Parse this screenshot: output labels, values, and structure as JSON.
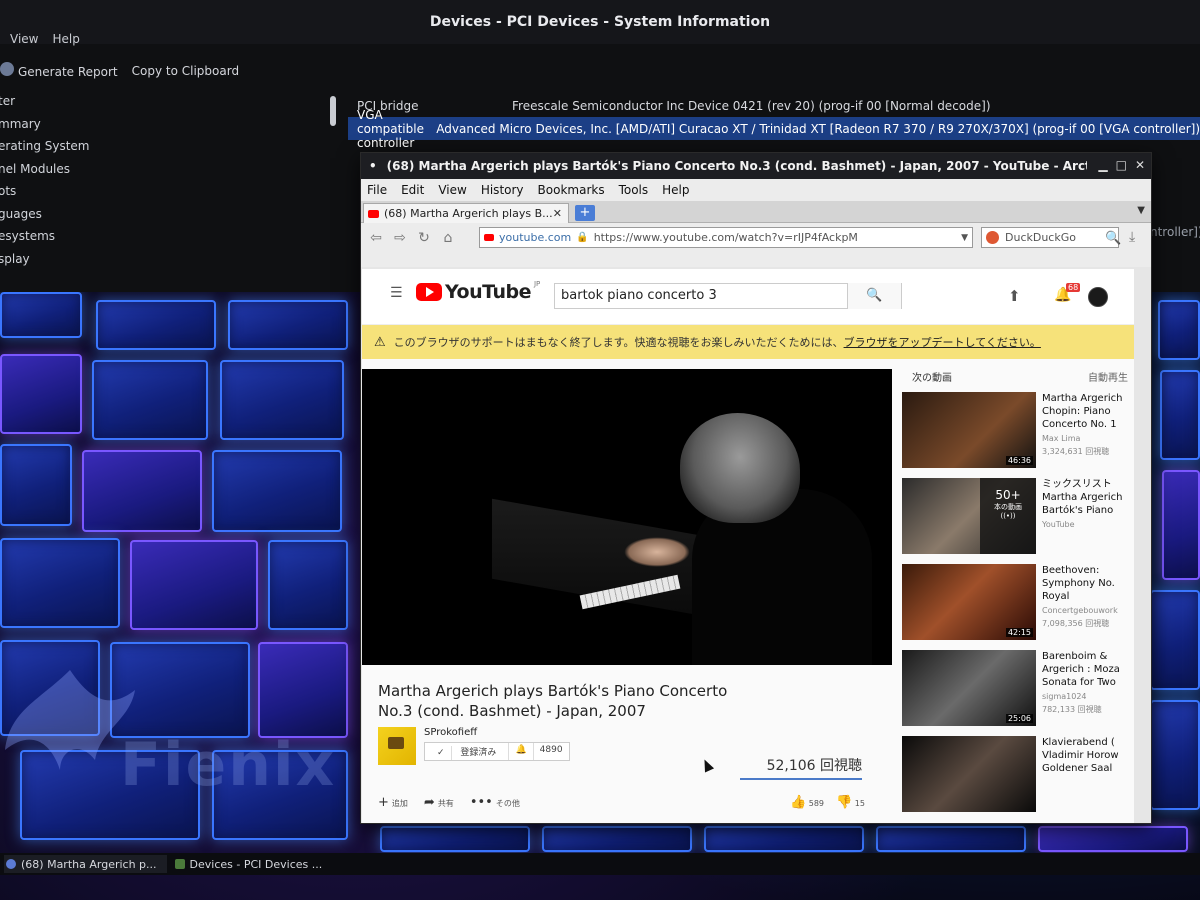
{
  "sysinfo": {
    "title": "Devices - PCI Devices - System Information",
    "menu": [
      "View",
      "Help"
    ],
    "toolbar": {
      "generate_report": "Generate Report",
      "copy_clipboard": "Copy to Clipboard"
    },
    "tree": [
      "ter",
      "mmary",
      "erating System",
      "nel Modules",
      "ots",
      "guages",
      "esystems",
      "splay"
    ],
    "rows": [
      {
        "key": "PCI bridge",
        "value": "Freescale Semiconductor Inc Device 0421 (rev 20) (prog-if 00 [Normal decode])"
      },
      {
        "key": "VGA compatible controller",
        "value": "Advanced Micro Devices, Inc. [AMD/ATI] Curacao XT / Trinidad XT [Radeon R7 370 / R9 270X/370X] (prog-if 00 [VGA controller])"
      }
    ],
    "row_tail": "ntroller])"
  },
  "desktop": {
    "logo_text": "Fienix"
  },
  "taskbar": {
    "items": [
      "(68) Martha Argerich p...",
      "Devices - PCI Devices ..."
    ]
  },
  "firefox": {
    "window_title": "(68) Martha Argerich plays Bartók's Piano Concerto No.3 (cond. Bashmet) - Japan, 2007 - YouTube - Arctic...",
    "menu": [
      "File",
      "Edit",
      "View",
      "History",
      "Bookmarks",
      "Tools",
      "Help"
    ],
    "tab_title": "(68) Martha Argerich plays B...",
    "url_site": "youtube.com",
    "url": "https://www.youtube.com/watch?v=rIJP4fAckpM",
    "search_engine": "DuckDuckGo"
  },
  "youtube": {
    "logo_word": "YouTube",
    "logo_region": "JP",
    "search_query": "bartok piano concerto 3",
    "notification_count": "68",
    "warning_text": "このブラウザのサポートはまもなく終了します。快適な視聴をお楽しみいただくためには、",
    "warning_link": "ブラウザをアップデートしてください。",
    "video_title": "Martha Argerich plays Bartók's Piano Concerto No.3 (cond. Bashmet) - Japan, 2007",
    "channel_name": "SProkofieff",
    "subscribed_label": "登録済み",
    "subscriber_count": "4890",
    "view_count": "52,106 回視聴",
    "actions": {
      "add": "追加",
      "share": "共有",
      "more": "その他"
    },
    "likes": "589",
    "dislikes": "15",
    "up_next_label": "次の動画",
    "autoplay_label": "自動再生",
    "recommendations": [
      {
        "title": "Martha Argerich Chopin: Piano Concerto No. 1",
        "channel": "Max Lima",
        "views": "3,324,631 回視聴",
        "duration": "46:36"
      },
      {
        "title": "ミックスリスト Martha Argerich Bartók's Piano",
        "channel": "YouTube",
        "views": "",
        "duration": "",
        "mix_count": "50+",
        "mix_label": "本の動画"
      },
      {
        "title": "Beethoven: Symphony No. Royal",
        "channel": "Concertgebouwork",
        "views": "7,098,356 回視聴",
        "duration": "42:15"
      },
      {
        "title": "Barenboim & Argerich : Moza Sonata for Two",
        "channel": "sigma1024",
        "views": "782,133 回視聴",
        "duration": "25:06"
      },
      {
        "title": "Klavierabend ( Vladimir Horow Goldener Saal",
        "channel": "",
        "views": "",
        "duration": ""
      }
    ]
  },
  "colors": {
    "selection": "#1c3f86",
    "youtube_red": "#ff0000",
    "warning_bg": "#f6e27a",
    "tile_glow": "#3a76ff"
  }
}
